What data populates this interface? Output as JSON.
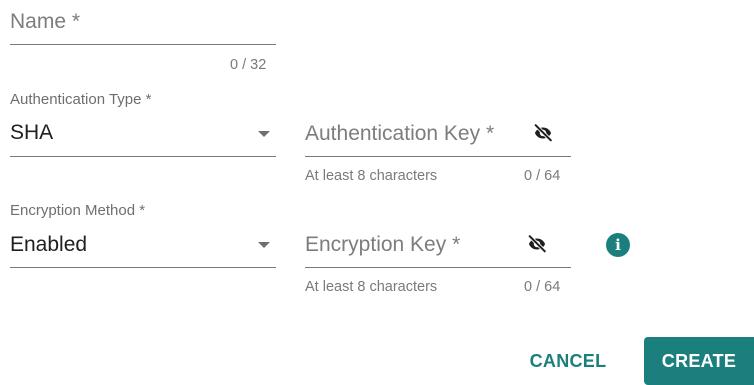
{
  "form": {
    "name": {
      "placeholder": "Name *",
      "counter": "0 / 32"
    },
    "auth_type": {
      "label": "Authentication Type *",
      "value": "SHA"
    },
    "auth_key": {
      "placeholder": "Authentication Key *",
      "hint": "At least 8 characters",
      "counter": "0 / 64"
    },
    "enc_method": {
      "label": "Encryption Method *",
      "value": "Enabled"
    },
    "enc_key": {
      "placeholder": "Encryption Key *",
      "hint": "At least 8 characters",
      "counter": "0 / 64"
    }
  },
  "icons": {
    "visibility_off": "visibility-off-icon",
    "info": "info-icon",
    "dropdown": "chevron-down-icon"
  },
  "actions": {
    "cancel": "CANCEL",
    "create": "CREATE"
  },
  "colors": {
    "primary": "#1b7f7e",
    "text": "#212121",
    "muted": "#7a7a7a"
  }
}
